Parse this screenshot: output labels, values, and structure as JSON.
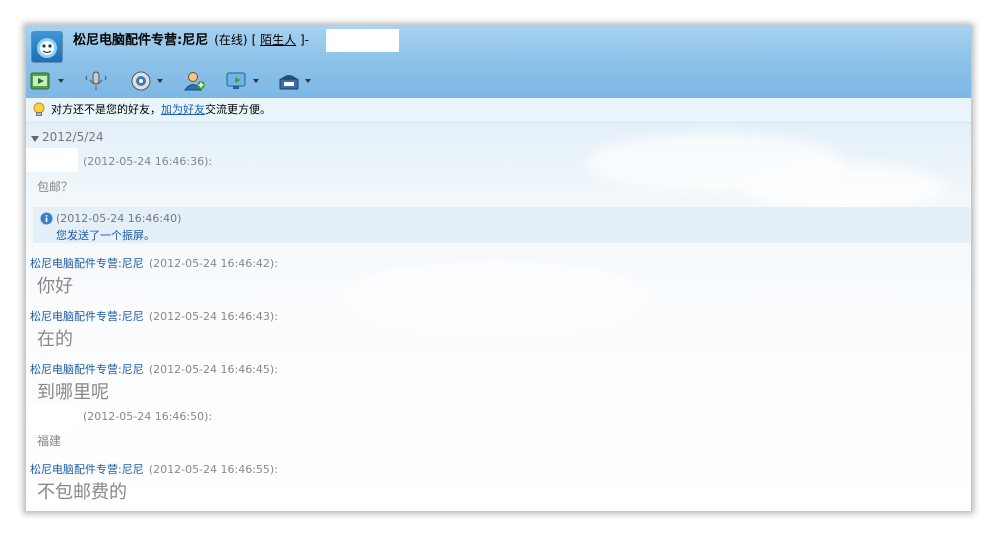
{
  "header": {
    "contact_name": "松尼电脑配件专营:尼尼",
    "status": "(在线)",
    "bracket_open": "[",
    "group_link": "陌生人",
    "bracket_close": "]",
    "separator": "-"
  },
  "toolbar": {
    "items": [
      {
        "icon": "send-file-icon",
        "has_dropdown": true
      },
      {
        "icon": "voice-icon",
        "has_dropdown": false
      },
      {
        "icon": "video-icon",
        "has_dropdown": true
      },
      {
        "icon": "add-contact-icon",
        "has_dropdown": false
      },
      {
        "icon": "remote-assist-icon",
        "has_dropdown": true
      },
      {
        "icon": "app-icon",
        "has_dropdown": true
      }
    ]
  },
  "notice": {
    "icon": "lightbulb-icon",
    "prefix": "对方还不是您的好友，",
    "link": "加为好友",
    "suffix": "交流更方便。"
  },
  "chat": {
    "date_header": "2012/5/24",
    "messages": [
      {
        "sender": "",
        "timestamp": "(2012-05-24 16:46:36):",
        "text": "包邮？",
        "size": "small"
      },
      {
        "system": true,
        "timestamp": "(2012-05-24 16:46:40)",
        "text": "您发送了一个振屏。"
      },
      {
        "sender": "松尼电脑配件专营:尼尼",
        "timestamp": "(2012-05-24 16:46:42):",
        "text": "你好",
        "size": "big"
      },
      {
        "sender": "松尼电脑配件专营:尼尼",
        "timestamp": "(2012-05-24 16:46:43):",
        "text": "在的",
        "size": "big"
      },
      {
        "sender": "松尼电脑配件专营:尼尼",
        "timestamp": "(2012-05-24 16:46:45):",
        "text": "到哪里呢",
        "size": "big"
      },
      {
        "sender": "",
        "timestamp": "(2012-05-24 16:46:50):",
        "text": "福建",
        "size": "small"
      },
      {
        "sender": "松尼电脑配件专营:尼尼",
        "timestamp": "(2012-05-24 16:46:55):",
        "text": "不包邮费的",
        "size": "big"
      }
    ]
  },
  "colors": {
    "header_blue": "#8ec3ea",
    "sender_blue": "#1d5aa3",
    "timestamp_gray": "#888888",
    "link_blue": "#1a5fb4"
  }
}
